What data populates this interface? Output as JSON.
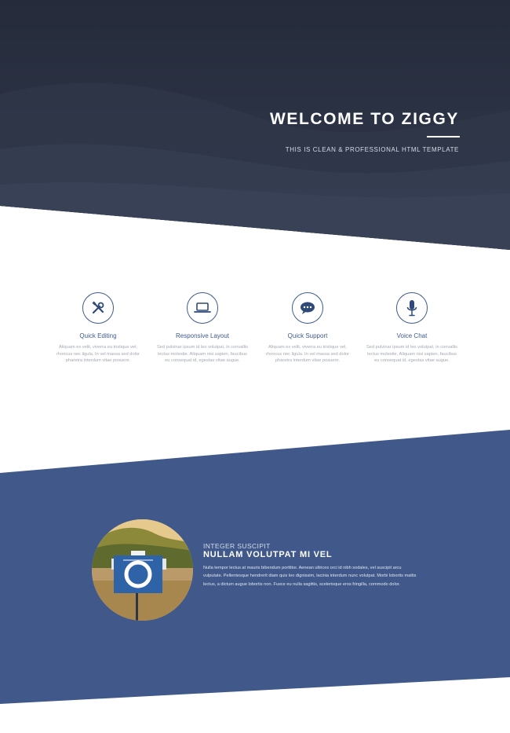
{
  "hero": {
    "title": "WELCOME TO ZIGGY",
    "subtitle": "THIS IS CLEAN & PROFESSIONAL HTML TEMPLATE"
  },
  "features": [
    {
      "icon": "tools-icon",
      "title": "Quick Editing",
      "text": "Aliquam ex velit, viverra eu tristique vel, rhoncus nec ligula. In vel massa sed dolor pharetra interdum vitae posuere."
    },
    {
      "icon": "laptop-icon",
      "title": "Responsive Layout",
      "text": "Sed pulvinar ipsum id leo volutpat, in convallis lectus molestie. Aliquam nisi sapien, faucibus eu consequat id, egestas vitae augue."
    },
    {
      "icon": "chat-bubble-icon",
      "title": "Quick Support",
      "text": "Aliquam ex velit, viverra eu tristique vel, rhoncus nec ligula. In vel massa sed dolor pharetra interdum vitae posuere."
    },
    {
      "icon": "microphone-icon",
      "title": "Voice Chat",
      "text": "Sed pulvinar ipsum id leo volutpat, in convallis lectus molestie. Aliquam nisi sapien, faucibus eu consequat id, egestas vitae augue."
    }
  ],
  "about": {
    "kicker": "INTEGER SUSCIPIT",
    "title": "NULLAM VOLUTPAT MI VEL",
    "text": "Nulla tempor lectus at mauris bibendum porttitor. Aenean ultrices orci id nibh sodales, vel suscipit arcu vulputate. Pellentesque hendrerit diam quis leo dignissim, lacinia interdum nunc volutpat. Morbi lobortis mattis lectus, a dictum augue lobortis non. Fusce eu nulla sagittis, scelerisque eros fringilla, commodo dolor."
  },
  "colors": {
    "hero_dark": "#2c3345",
    "accent_blue": "#41598a",
    "icon_blue": "#3e5b8d",
    "muted_text": "#a3a8b2"
  }
}
